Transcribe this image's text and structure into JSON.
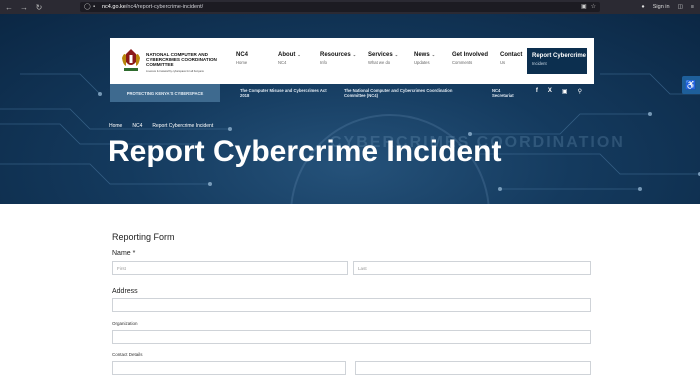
{
  "browser": {
    "url_host": "nc4.go.ke",
    "url_path": "/nc4/report-cybercrime-incident/",
    "sign_in": "Sign in"
  },
  "header": {
    "org_name": "National Computer and Cybercrimes Coordination Committee",
    "org_tag": "A secure & trustworthy cyberspace for all Kenyans",
    "menu": [
      {
        "label": "NC4",
        "sub": "Home",
        "chevron": false
      },
      {
        "label": "About",
        "sub": "NC4",
        "chevron": true
      },
      {
        "label": "Resources",
        "sub": "Info",
        "chevron": true
      },
      {
        "label": "Services",
        "sub": "What we do",
        "chevron": true
      },
      {
        "label": "News",
        "sub": "Updates",
        "chevron": true
      },
      {
        "label": "Get Involved",
        "sub": "Comments",
        "chevron": false
      },
      {
        "label": "Contact",
        "sub": "Us",
        "chevron": false
      }
    ],
    "cta_label": "Report Cybercrime",
    "cta_sub": "Incident"
  },
  "secbar": {
    "protect": "Protecting Kenya's Cyberspace",
    "link1": "The Computer Misuse and Cybercrimes Act 2018",
    "link2": "The National Computer and Cybercrimes Coordination Committee (NC4)",
    "link3": "NC4 Secretariat",
    "socials": [
      "facebook-icon",
      "x-icon",
      "instagram-icon",
      "search-icon"
    ]
  },
  "breadcrumb": {
    "home": "Home",
    "nc4": "NC4",
    "current": "Report Cybercrime Incident"
  },
  "page_title": "Report Cybercrime Incident",
  "hero_watermark": "CYBERCRIMES COORDINATION",
  "form": {
    "title": "Reporting Form",
    "name_label": "Name *",
    "first_placeholder": "First",
    "last_placeholder": "Last",
    "address_label": "Address",
    "organization_label": "Organization",
    "contact_label": "Contact Details"
  },
  "colors": {
    "navy": "#0c2f4f",
    "hero": "#143a5e",
    "bar": "#3e6a8f"
  }
}
